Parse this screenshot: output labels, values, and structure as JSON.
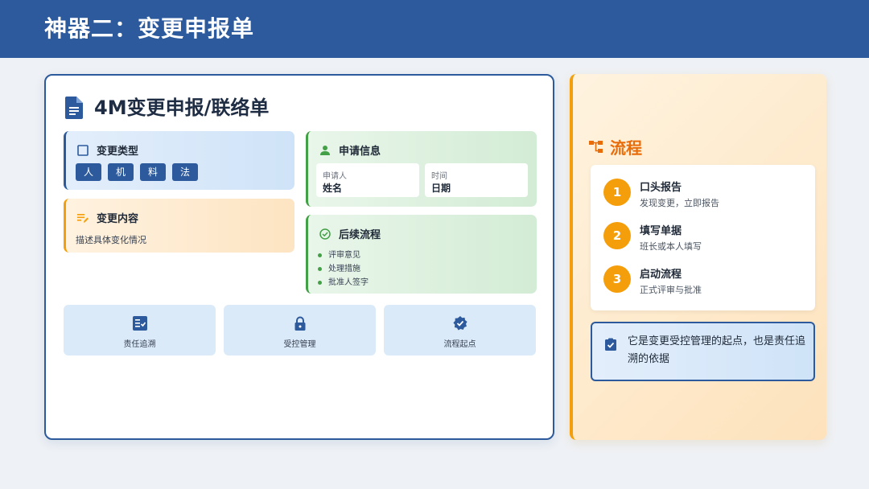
{
  "header": {
    "title": "神器二：变更申报单"
  },
  "form": {
    "title": "4M变更申报/联络单",
    "change_type": {
      "label": "变更类型",
      "tags": [
        "人",
        "机",
        "料",
        "法"
      ]
    },
    "change_content": {
      "label": "变更内容",
      "description": "描述具体变化情况"
    },
    "application": {
      "label": "申请信息",
      "fields": [
        {
          "label": "申请人",
          "value": "姓名"
        },
        {
          "label": "时间",
          "value": "日期"
        }
      ]
    },
    "follow_up": {
      "label": "后续流程",
      "items": [
        "评审意见",
        "处理措施",
        "批准人签字"
      ]
    },
    "features": [
      {
        "icon": "checklist-icon",
        "label": "责任追溯"
      },
      {
        "icon": "lock-icon",
        "label": "受控管理"
      },
      {
        "icon": "verified-badge-icon",
        "label": "流程起点"
      }
    ]
  },
  "process": {
    "title": "流程",
    "steps": [
      {
        "number": "1",
        "title": "口头报告",
        "desc": "发现变更，立即报告"
      },
      {
        "number": "2",
        "title": "填写单据",
        "desc": "班长或本人填写"
      },
      {
        "number": "3",
        "title": "启动流程",
        "desc": "正式评审与批准"
      }
    ],
    "note": "它是变更受控管理的起点，也是责任追溯的依据"
  },
  "colors": {
    "primary_blue": "#2c5a9c",
    "accent_orange": "#f59e0b",
    "process_title_orange": "#e86d0a",
    "green": "#43a047"
  }
}
